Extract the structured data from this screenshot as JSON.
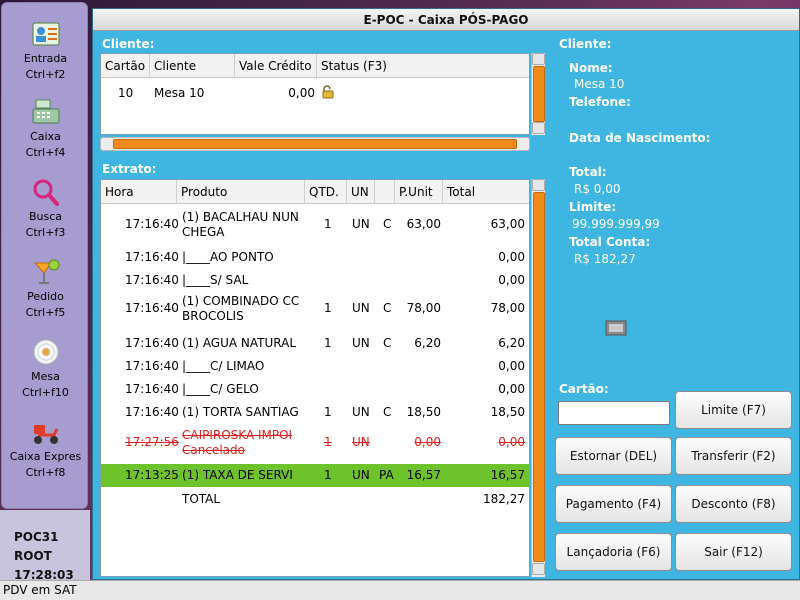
{
  "window": {
    "title": "E-POC - Caixa PÓS-PAGO"
  },
  "launcher": {
    "items": [
      {
        "label": "Entrada",
        "shortcut": "Ctrl+f2",
        "icon": "address-card-icon"
      },
      {
        "label": "Caixa",
        "shortcut": "Ctrl+f4",
        "icon": "cash-register-icon"
      },
      {
        "label": "Busca",
        "shortcut": "Ctrl+f3",
        "icon": "magnifier-icon"
      },
      {
        "label": "Pedido",
        "shortcut": "Ctrl+f5",
        "icon": "cocktail-icon"
      },
      {
        "label": "Mesa",
        "shortcut": "Ctrl+f10",
        "icon": "plate-icon"
      },
      {
        "label": "Caixa Expres",
        "shortcut": "Ctrl+f8",
        "icon": "scooter-icon"
      }
    ]
  },
  "sys_info": {
    "terminal": "POC31",
    "user": "ROOT",
    "time": "17:28:03"
  },
  "cliente_section": {
    "label": "Cliente:",
    "columns": [
      "Cartão",
      "Cliente",
      "Vale Crédito",
      "Status (F3)"
    ],
    "rows": [
      {
        "cartao": "10",
        "cliente": "Mesa 10",
        "vale_credito": "0,00",
        "status_icon": "unlocked-padlock-icon"
      }
    ]
  },
  "extrato_section": {
    "label": "Extrato:",
    "columns": [
      "Hora",
      "Produto",
      "QTD.",
      "UN",
      "",
      "P.Unit",
      "Total"
    ],
    "rows": [
      {
        "hora": "17:16:40",
        "produto": "(1) BACALHAU NUN",
        "produto2": "CHEGA",
        "qtd": "1",
        "un": "UN",
        "c": "C",
        "punit": "63,00",
        "total": "63,00",
        "style": "normal"
      },
      {
        "hora": "17:16:40",
        "produto": "|____AO PONTO",
        "produto2": "",
        "qtd": "",
        "un": "",
        "c": "",
        "punit": "",
        "total": "0,00",
        "style": "normal"
      },
      {
        "hora": "17:16:40",
        "produto": "|____S/ SAL",
        "produto2": "",
        "qtd": "",
        "un": "",
        "c": "",
        "punit": "",
        "total": "0,00",
        "style": "normal"
      },
      {
        "hora": "17:16:40",
        "produto": "(1) COMBINADO CC",
        "produto2": "BROCOLIS",
        "qtd": "1",
        "un": "UN",
        "c": "C",
        "punit": "78,00",
        "total": "78,00",
        "style": "normal"
      },
      {
        "hora": "17:16:40",
        "produto": "(1) AGUA NATURAL",
        "produto2": "",
        "qtd": "1",
        "un": "UN",
        "c": "C",
        "punit": "6,20",
        "total": "6,20",
        "style": "normal"
      },
      {
        "hora": "17:16:40",
        "produto": "|____C/ LIMAO",
        "produto2": "",
        "qtd": "",
        "un": "",
        "c": "",
        "punit": "",
        "total": "0,00",
        "style": "normal"
      },
      {
        "hora": "17:16:40",
        "produto": "|____C/ GELO",
        "produto2": "",
        "qtd": "",
        "un": "",
        "c": "",
        "punit": "",
        "total": "0,00",
        "style": "normal"
      },
      {
        "hora": "17:16:40",
        "produto": "(1) TORTA SANTIAG",
        "produto2": "",
        "qtd": "1",
        "un": "UN",
        "c": "C",
        "punit": "18,50",
        "total": "18,50",
        "style": "normal"
      },
      {
        "hora": "17:27:56",
        "produto": "CAIPIROSKA IMPOI",
        "produto2": "Cancelado",
        "qtd": "1",
        "un": "UN",
        "c": "",
        "punit": "0,00",
        "total": "0,00",
        "style": "cancelled"
      },
      {
        "hora": "17:13:25",
        "produto": "(1) TAXA DE SERVI",
        "produto2": "",
        "qtd": "1",
        "un": "UN",
        "c": "PA",
        "punit": "16,57",
        "total": "16,57",
        "style": "selected"
      }
    ],
    "total_label": "TOTAL",
    "total_value": "182,27"
  },
  "client_info": {
    "header": "Cliente:",
    "nome_label": "Nome:",
    "nome_value": "Mesa 10",
    "telefone_label": "Telefone:",
    "nascimento_label": "Data de Nascimento:",
    "total_label": "Total:",
    "total_value": "R$ 0,00",
    "limite_label": "Limite:",
    "limite_value": "99.999.999,99",
    "total_conta_label": "Total Conta:",
    "total_conta_value": "R$ 182,27"
  },
  "cartao": {
    "label": "Cartão:",
    "value": ""
  },
  "buttons": {
    "limite": "Limite (F7)",
    "estornar": "Estornar (DEL)",
    "transferir": "Transferir (F2)",
    "pagamento": "Pagamento (F4)",
    "desconto": "Desconto (F8)",
    "lancadoria": "Lançadoria (F6)",
    "sair": "Sair (F12)"
  },
  "statusbar": {
    "text": "PDV em  SAT"
  },
  "colors": {
    "window_bg": "#3fb6e2",
    "scroll_accent": "#f08a1a",
    "selected_row": "#6ec22b",
    "cancelled_text": "#e02020"
  }
}
